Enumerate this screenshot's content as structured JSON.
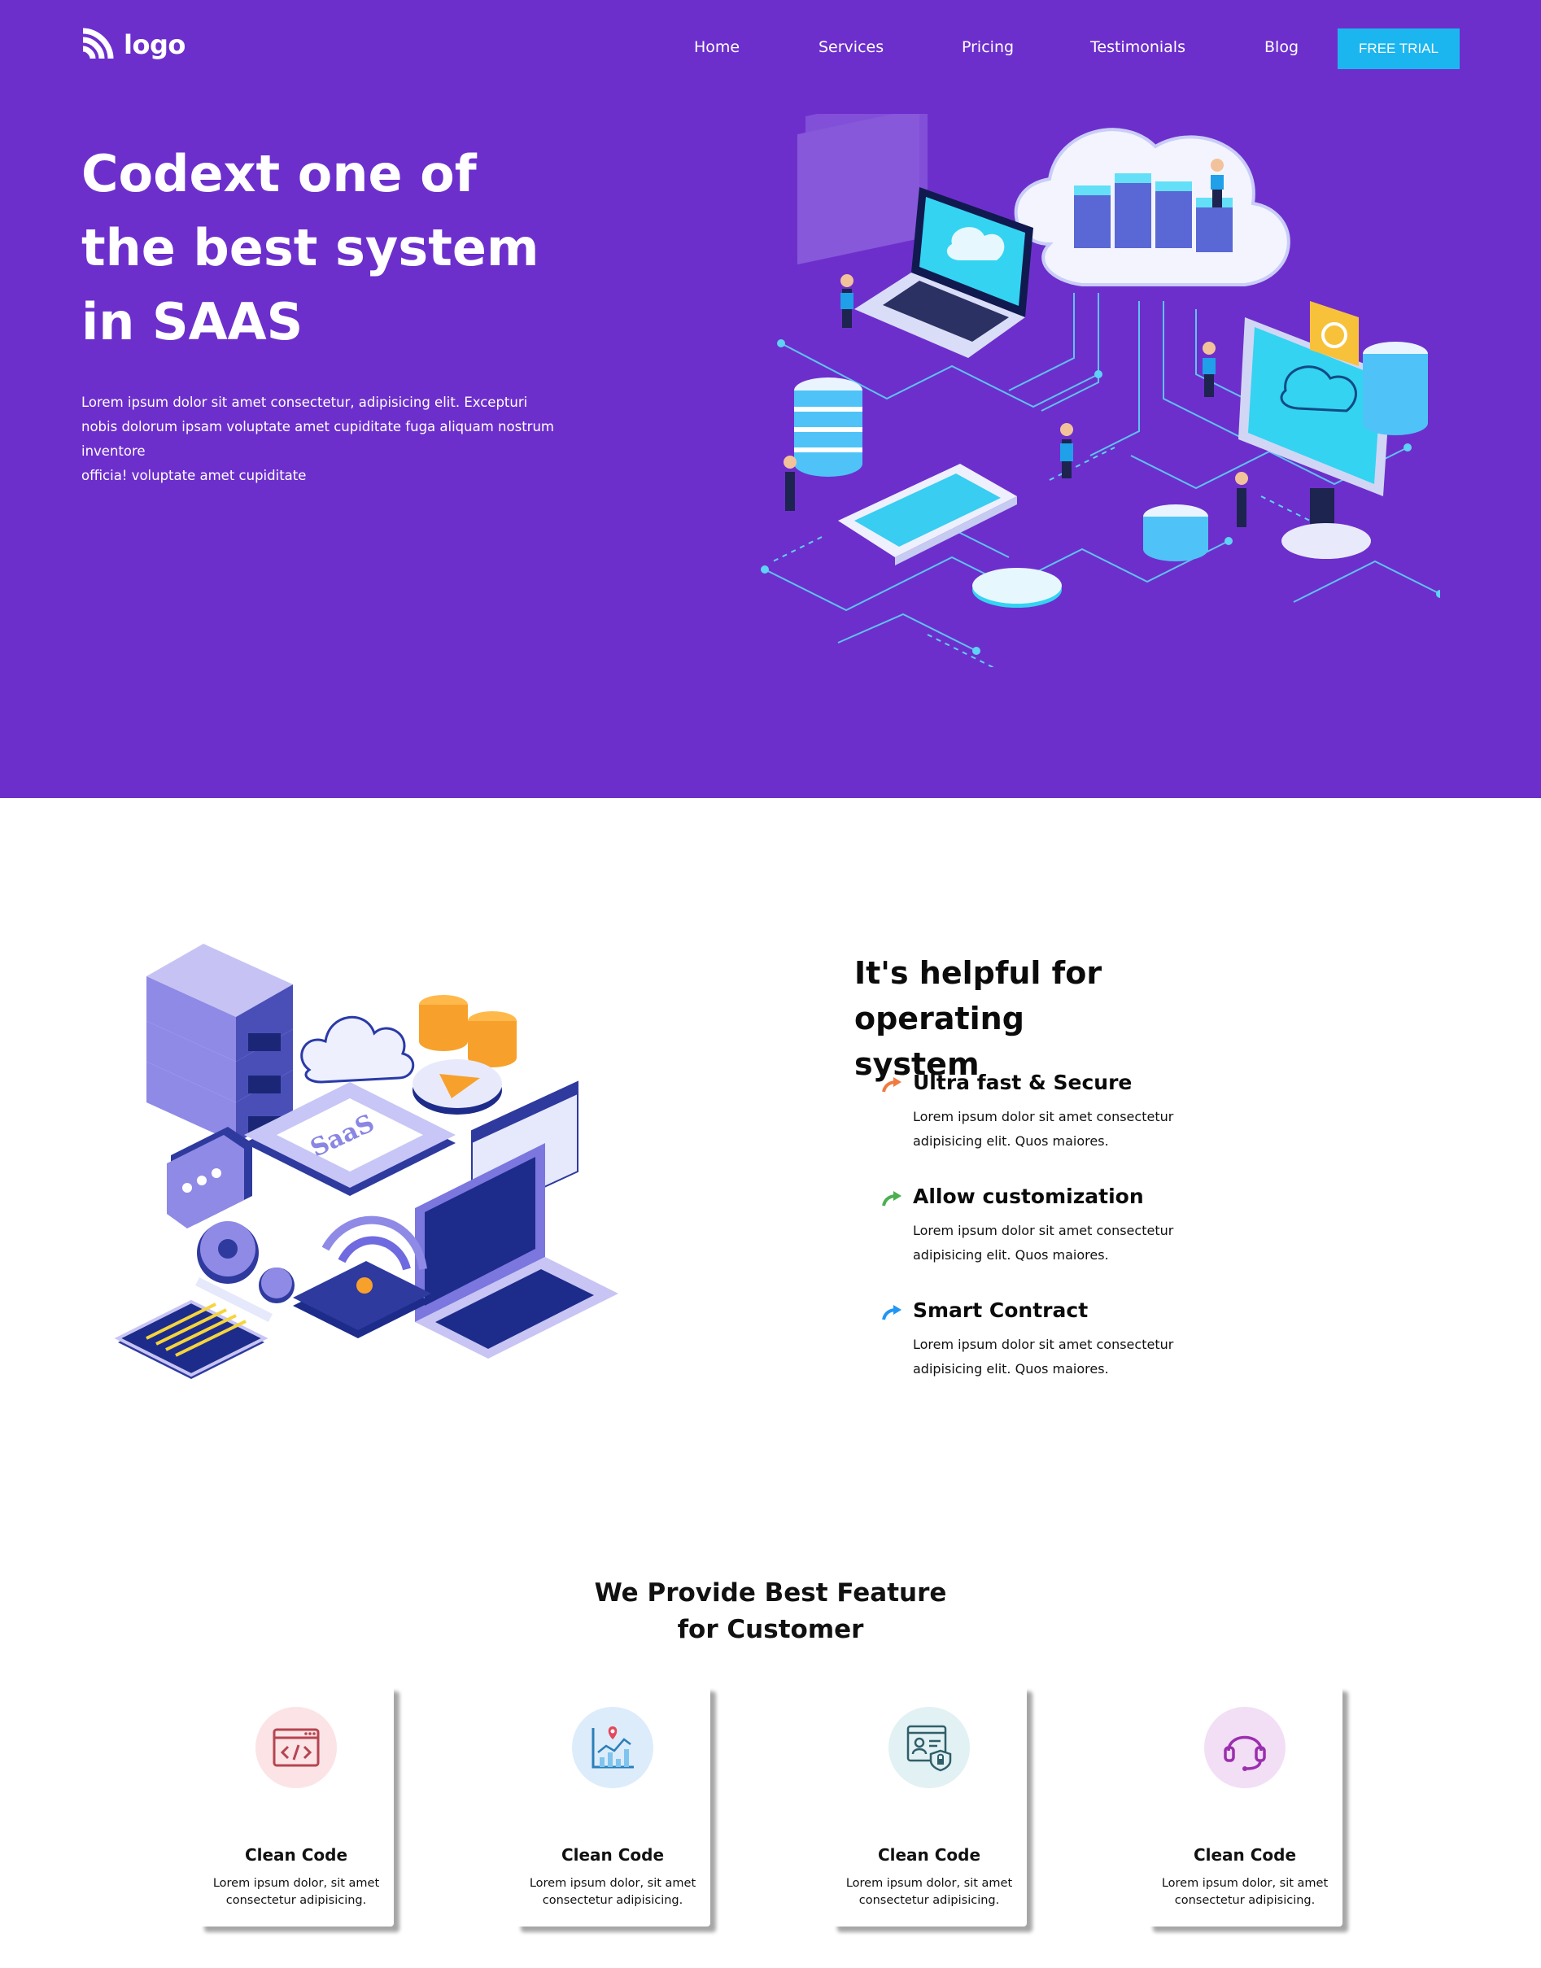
{
  "header": {
    "logo_text": "logo",
    "nav": [
      "Home",
      "Services",
      "Pricing",
      "Testimonials",
      "Blog"
    ],
    "cta": "FREE TRIAL"
  },
  "hero": {
    "title_lines": [
      "Codext one of",
      "the best system",
      "in SAAS"
    ],
    "text_lines": [
      "Lorem ipsum dolor sit amet consectetur, adipisicing elit. Excepturi",
      "nobis dolorum ipsam voluptate amet cupiditate fuga aliquam nostrum inventore",
      "officia! voluptate amet cupiditate"
    ]
  },
  "about": {
    "title_lines": [
      "It's helpful for operating",
      "system"
    ],
    "illustration_label": "SaaS",
    "features": [
      {
        "title": "Ultra fast & Secure",
        "text_lines": [
          "Lorem ipsum dolor sit amet consectetur",
          "adipisicing elit. Quos maiores."
        ],
        "arrow_color": "#f07b3f"
      },
      {
        "title": "Allow customization",
        "text_lines": [
          "Lorem ipsum dolor sit amet consectetur",
          "adipisicing elit. Quos maiores."
        ],
        "arrow_color": "#4caf50"
      },
      {
        "title": "Smart Contract",
        "text_lines": [
          "Lorem ipsum dolor sit amet consectetur",
          "adipisicing elit. Quos maiores."
        ],
        "arrow_color": "#2196f3"
      }
    ]
  },
  "services": {
    "title_lines": [
      "We Provide Best Feature",
      "for Customer"
    ],
    "cards": [
      {
        "icon": "code-window-icon",
        "bg": "#fbe3e6",
        "title": "Clean Code",
        "text_lines": [
          "Lorem ipsum dolor, sit amet",
          "consectetur adipisicing."
        ]
      },
      {
        "icon": "analytics-chart-icon",
        "bg": "#dcecfb",
        "title": "Clean Code",
        "text_lines": [
          "Lorem ipsum dolor, sit amet",
          "consectetur adipisicing."
        ]
      },
      {
        "icon": "secure-profile-icon",
        "bg": "#e2f1f3",
        "title": "Clean Code",
        "text_lines": [
          "Lorem ipsum dolor, sit amet",
          "consectetur adipisicing."
        ]
      },
      {
        "icon": "headset-support-icon",
        "bg": "#f2def5",
        "title": "Clean Code",
        "text_lines": [
          "Lorem ipsum dolor, sit amet",
          "consectetur adipisicing."
        ]
      }
    ]
  },
  "colors": {
    "hero_bg": "#6d2fcc",
    "cta_bg": "#1bb6ef"
  }
}
